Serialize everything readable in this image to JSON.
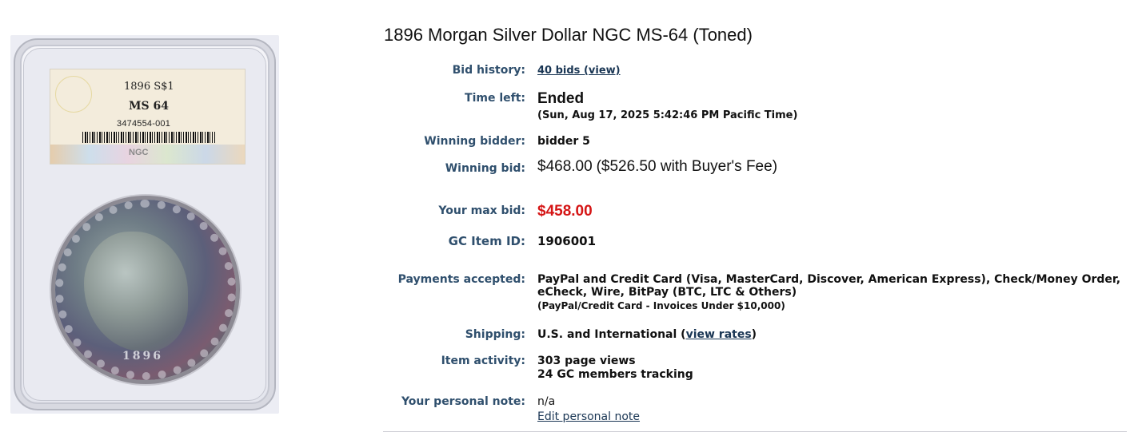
{
  "slab": {
    "label_line": "1896 S$1",
    "grade": "MS 64",
    "cert_number": "3474554-001",
    "grader_mark": "NGC",
    "coin_date": "1896"
  },
  "lot": {
    "title": "1896 Morgan Silver Dollar NGC MS-64 (Toned)",
    "bid_history": {
      "label": "Bid history:",
      "link": "40 bids (view)"
    },
    "time_left": {
      "label": "Time left:",
      "status": "Ended",
      "ended_at": "(Sun, Aug 17, 2025 5:42:46 PM Pacific Time)"
    },
    "winning_bidder": {
      "label": "Winning bidder:",
      "value": "bidder 5"
    },
    "winning_bid": {
      "label": "Winning bid:",
      "amount": "$468.00",
      "with_fee": "($526.50 with Buyer's Fee)"
    },
    "your_max_bid": {
      "label": "Your max bid:",
      "amount": "$458.00"
    },
    "item_id": {
      "label": "GC Item ID:",
      "value": "1906001"
    },
    "payments": {
      "label": "Payments accepted:",
      "value": "PayPal and Credit Card (Visa, MasterCard, Discover, American Express), Check/Money Order, eCheck, Wire, BitPay (BTC, LTC & Others)",
      "note": "(PayPal/Credit Card - Invoices Under $10,000)"
    },
    "shipping": {
      "label": "Shipping:",
      "value": "U.S. and International (",
      "link": "view rates",
      "close": ")"
    },
    "activity": {
      "label": "Item activity:",
      "page_views": "303 page views",
      "tracking": "24 GC members tracking"
    },
    "personal_note": {
      "label": "Your personal note:",
      "value": "n/a",
      "edit_link": "Edit personal note"
    }
  },
  "colors": {
    "label_blue": "#2f4f6d",
    "max_bid_red": "#d51515",
    "link_blue": "#1a3654"
  }
}
